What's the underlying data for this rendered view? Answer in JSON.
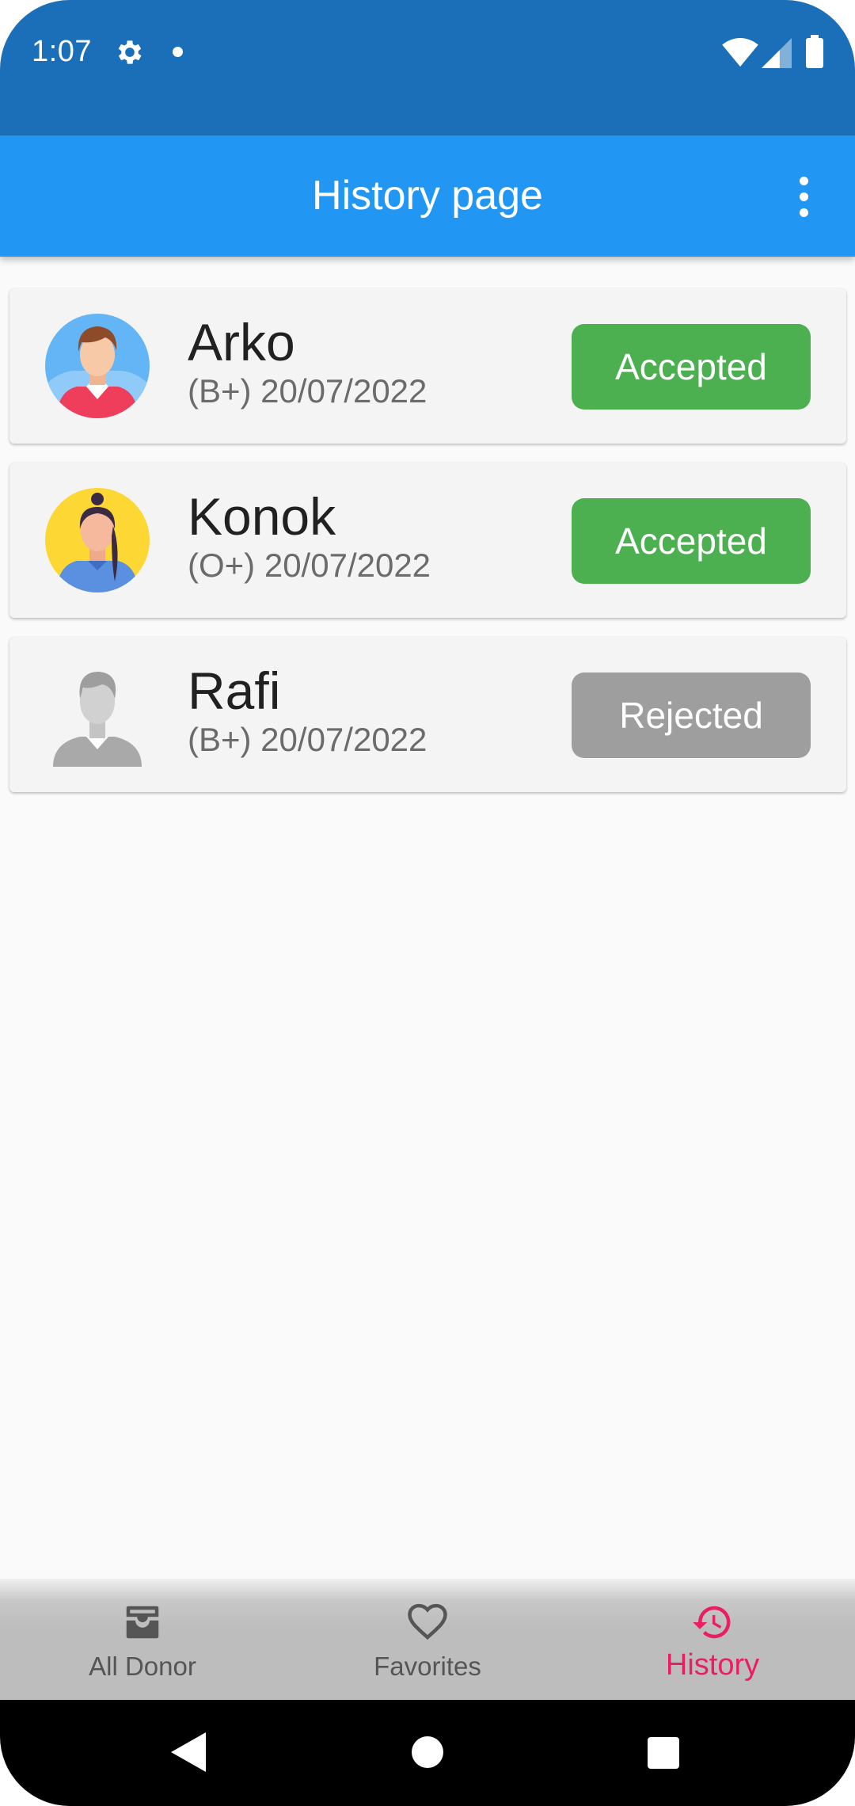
{
  "status_bar": {
    "time": "1:07"
  },
  "app_bar": {
    "title": "History page",
    "more_icon": "more-vert-icon"
  },
  "history": [
    {
      "name": "Arko",
      "subtitle": "(B+) 20/07/2022",
      "status": "Accepted",
      "status_color": "#4caf50",
      "avatar": "male-avatar-icon"
    },
    {
      "name": "Konok",
      "subtitle": "(O+) 20/07/2022",
      "status": "Accepted",
      "status_color": "#4caf50",
      "avatar": "female-avatar-icon"
    },
    {
      "name": "Rafi",
      "subtitle": "(B+) 20/07/2022",
      "status": "Rejected",
      "status_color": "#9e9e9e",
      "avatar": "default-avatar-icon"
    }
  ],
  "bottom_nav": {
    "items": [
      {
        "label": "All Donor",
        "icon": "inbox-icon",
        "active": false
      },
      {
        "label": "Favorites",
        "icon": "heart-icon",
        "active": false
      },
      {
        "label": "History",
        "icon": "history-icon",
        "active": true
      }
    ]
  },
  "colors": {
    "status_bar": "#1a6fb8",
    "app_bar": "#2196f3",
    "accent": "#e91e63",
    "accepted": "#4caf50",
    "rejected": "#9e9e9e"
  }
}
